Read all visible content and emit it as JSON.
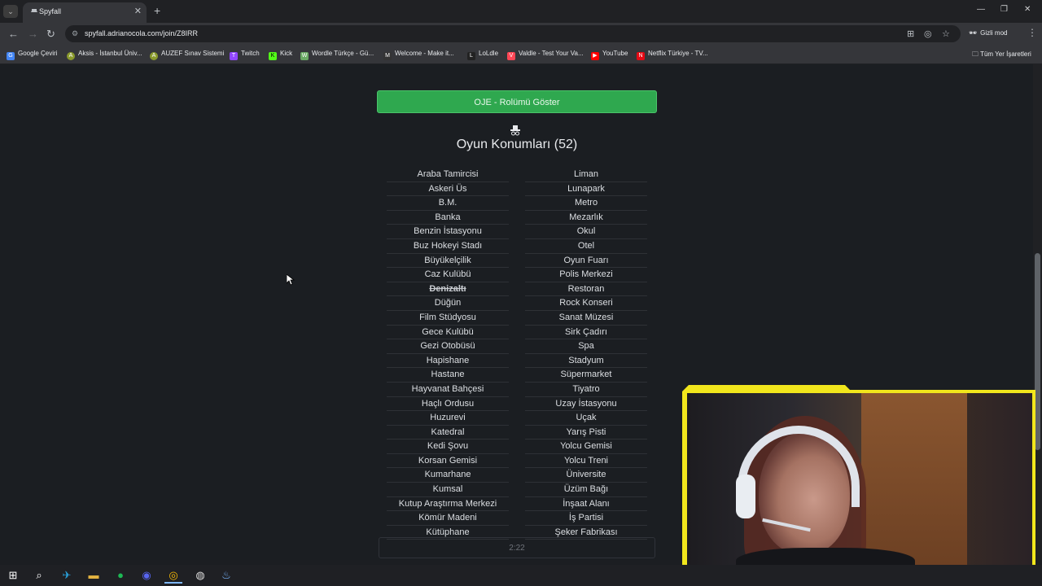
{
  "browser": {
    "tab_title": "Spyfall",
    "url": "spyfall.adrianocola.com/join/Z8IRR",
    "incognito_label": "Gizli mod",
    "bookmarks": [
      {
        "label": "Google Çeviri",
        "color": "#4285f4",
        "icon": "G"
      },
      {
        "label": "Aksis - İstanbul Üniv...",
        "color": "#8a9a2c",
        "icon": "A"
      },
      {
        "label": "AUZEF Sınav Sistemi",
        "color": "#8a9a2c",
        "icon": "A"
      },
      {
        "label": "Twitch",
        "color": "#9146ff",
        "icon": "T"
      },
      {
        "label": "Kick",
        "color": "#53fc18",
        "icon": "K"
      },
      {
        "label": "Wordle Türkçe - Gü...",
        "color": "#6aaa64",
        "icon": "W"
      },
      {
        "label": "Welcome - Make it...",
        "color": "#333333",
        "icon": "M"
      },
      {
        "label": "LoLdle",
        "color": "#222222",
        "icon": "L"
      },
      {
        "label": "Valdle - Test Your Va...",
        "color": "#ff4655",
        "icon": "V"
      },
      {
        "label": "YouTube",
        "color": "#ff0000",
        "icon": "▶"
      },
      {
        "label": "Netflix Türkiye - TV...",
        "color": "#e50914",
        "icon": "N"
      }
    ],
    "all_bookmarks_label": "Tüm Yer İşaretleri"
  },
  "game": {
    "role_button": "OJE - Rolümü Göster",
    "heading": "Oyun Konumları (52)",
    "locations_left": [
      "Araba Tamircisi",
      "Askeri Üs",
      "B.M.",
      "Banka",
      "Benzin İstasyonu",
      "Buz Hokeyi Stadı",
      "Büyükelçilik",
      "Caz Kulübü",
      "Denizaltı",
      "Düğün",
      "Film Stüdyosu",
      "Gece Kulübü",
      "Gezi Otobüsü",
      "Hapishane",
      "Hastane",
      "Hayvanat Bahçesi",
      "Haçlı Ordusu",
      "Huzurevi",
      "Katedral",
      "Kedi Şovu",
      "Korsan Gemisi",
      "Kumarhane",
      "Kumsal",
      "Kutup Araştırma Merkezi",
      "Kömür Madeni",
      "Kütüphane"
    ],
    "locations_right": [
      "Liman",
      "Lunapark",
      "Metro",
      "Mezarlık",
      "Okul",
      "Otel",
      "Oyun Fuarı",
      "Polis Merkezi",
      "Restoran",
      "Rock Konseri",
      "Sanat Müzesi",
      "Sirk Çadırı",
      "Spa",
      "Stadyum",
      "Süpermarket",
      "Tiyatro",
      "Uzay İstasyonu",
      "Uçak",
      "Yarış Pisti",
      "Yolcu Gemisi",
      "Yolcu Treni",
      "Üniversite",
      "Üzüm Bağı",
      "İnşaat Alanı",
      "İş Partisi",
      "Şeker Fabrikası"
    ],
    "crossed_out": [
      "Denizaltı"
    ],
    "timer": "2:22"
  },
  "colors": {
    "accent_green": "#2fa84f",
    "webcam_frame": "#f1e61c"
  }
}
